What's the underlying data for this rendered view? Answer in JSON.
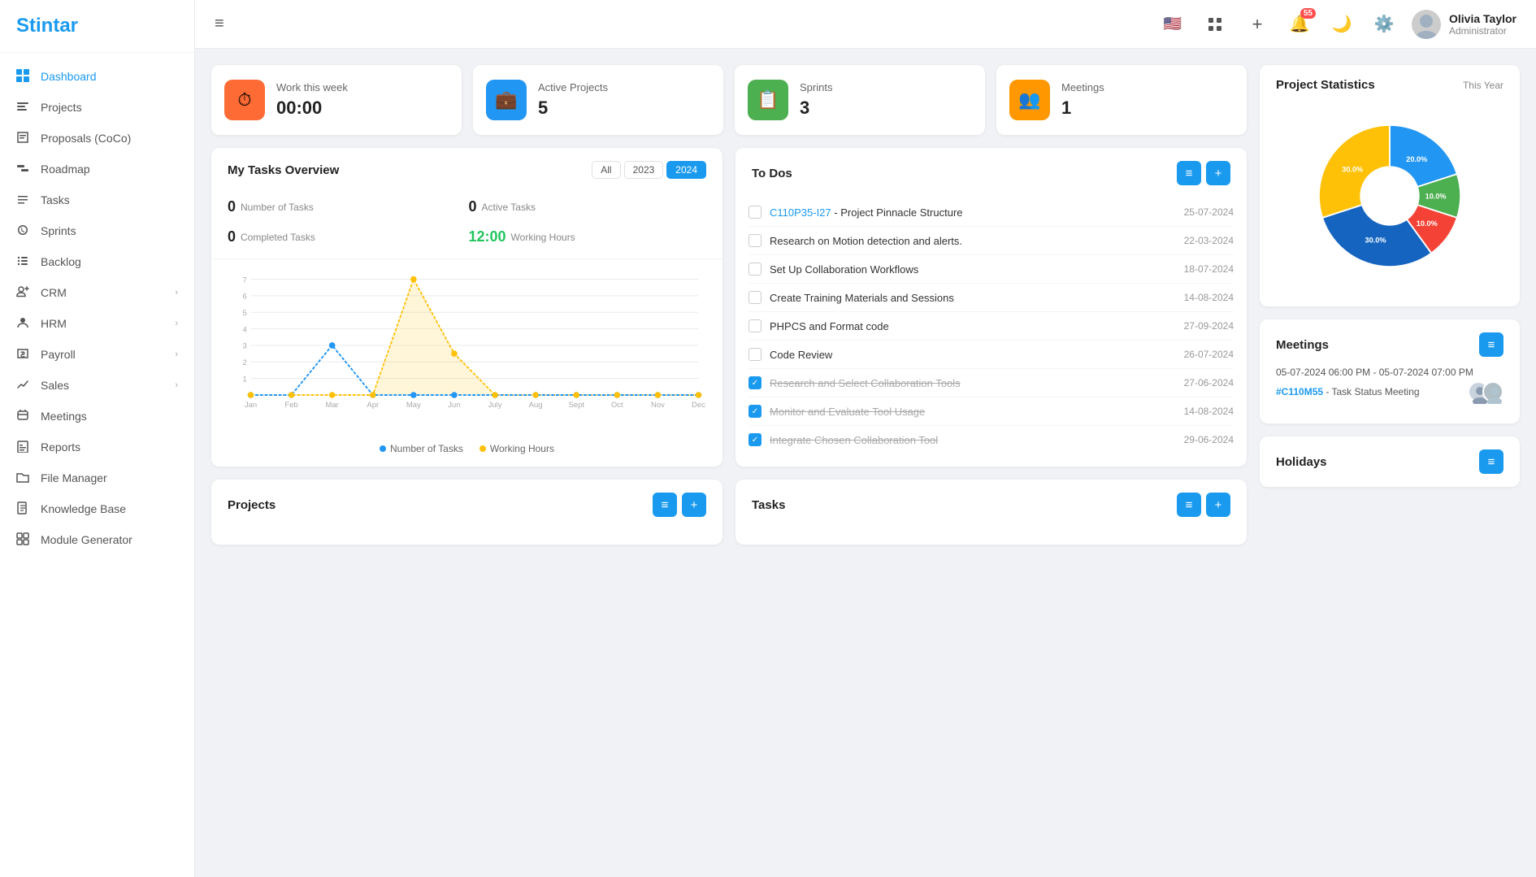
{
  "app": {
    "name": "Stintar"
  },
  "header": {
    "hamburger": "≡",
    "notifications_badge": "55",
    "user": {
      "name": "Olivia Taylor",
      "role": "Administrator"
    }
  },
  "sidebar": {
    "items": [
      {
        "id": "dashboard",
        "label": "Dashboard",
        "icon": "dashboard",
        "active": true,
        "hasArrow": false
      },
      {
        "id": "projects",
        "label": "Projects",
        "icon": "projects",
        "active": false,
        "hasArrow": false
      },
      {
        "id": "proposals",
        "label": "Proposals (CoCo)",
        "icon": "proposals",
        "active": false,
        "hasArrow": false
      },
      {
        "id": "roadmap",
        "label": "Roadmap",
        "icon": "roadmap",
        "active": false,
        "hasArrow": false
      },
      {
        "id": "tasks",
        "label": "Tasks",
        "icon": "tasks",
        "active": false,
        "hasArrow": false
      },
      {
        "id": "sprints",
        "label": "Sprints",
        "icon": "sprints",
        "active": false,
        "hasArrow": false
      },
      {
        "id": "backlog",
        "label": "Backlog",
        "icon": "backlog",
        "active": false,
        "hasArrow": false
      },
      {
        "id": "crm",
        "label": "CRM",
        "icon": "crm",
        "active": false,
        "hasArrow": true
      },
      {
        "id": "hrm",
        "label": "HRM",
        "icon": "hrm",
        "active": false,
        "hasArrow": true
      },
      {
        "id": "payroll",
        "label": "Payroll",
        "icon": "payroll",
        "active": false,
        "hasArrow": true
      },
      {
        "id": "sales",
        "label": "Sales",
        "icon": "sales",
        "active": false,
        "hasArrow": true
      },
      {
        "id": "meetings",
        "label": "Meetings",
        "icon": "meetings",
        "active": false,
        "hasArrow": false
      },
      {
        "id": "reports",
        "label": "Reports",
        "icon": "reports",
        "active": false,
        "hasArrow": false
      },
      {
        "id": "filemanager",
        "label": "File Manager",
        "icon": "filemanager",
        "active": false,
        "hasArrow": false
      },
      {
        "id": "knowledgebase",
        "label": "Knowledge Base",
        "icon": "knowledgebase",
        "active": false,
        "hasArrow": false
      },
      {
        "id": "modulegenerator",
        "label": "Module Generator",
        "icon": "modulegenerator",
        "active": false,
        "hasArrow": false
      }
    ]
  },
  "stat_cards": [
    {
      "id": "work_this_week",
      "icon": "⏱",
      "icon_bg": "#ff6b35",
      "label": "Work this week",
      "value": "00:00"
    },
    {
      "id": "active_projects",
      "icon": "💼",
      "icon_bg": "#2196f3",
      "label": "Active Projects",
      "value": "5"
    },
    {
      "id": "sprints",
      "icon": "📋",
      "icon_bg": "#4caf50",
      "label": "Sprints",
      "value": "3"
    },
    {
      "id": "meetings",
      "icon": "👥",
      "icon_bg": "#ff9800",
      "label": "Meetings",
      "value": "1"
    }
  ],
  "tasks_overview": {
    "title": "My Tasks Overview",
    "tabs": [
      "All",
      "2023",
      "2024"
    ],
    "active_tab": "2024",
    "stats": [
      {
        "num": "0",
        "label": "Number of Tasks"
      },
      {
        "num": "0",
        "label": "Active Tasks"
      },
      {
        "num": "0",
        "label": "Completed Tasks"
      },
      {
        "num": "12:00",
        "label": "Working Hours",
        "green": true
      }
    ],
    "chart_months": [
      "Jan",
      "Feb",
      "Mar",
      "Apr",
      "May",
      "Jun",
      "July",
      "Aug",
      "Sept",
      "Oct",
      "Nov",
      "Dec"
    ],
    "chart_tasks": [
      0,
      0,
      3,
      0,
      0,
      0,
      0,
      0,
      0,
      0,
      0,
      0
    ],
    "chart_hours": [
      0,
      0,
      0,
      0,
      7,
      2.5,
      0,
      0,
      0,
      0,
      0,
      0
    ],
    "legend": [
      {
        "label": "Number of Tasks",
        "color": "#2196f3"
      },
      {
        "label": "Working Hours",
        "color": "#ffc107"
      }
    ]
  },
  "todos": {
    "title": "To Dos",
    "items": [
      {
        "id": "t1",
        "checked": false,
        "link": "C110P35-I27",
        "text": " - Project Pinnacle Structure",
        "date": "25-07-2024"
      },
      {
        "id": "t2",
        "checked": false,
        "link": "",
        "text": "Research on Motion detection and alerts.",
        "date": "22-03-2024"
      },
      {
        "id": "t3",
        "checked": false,
        "link": "",
        "text": "Set Up Collaboration Workflows",
        "date": "18-07-2024"
      },
      {
        "id": "t4",
        "checked": false,
        "link": "",
        "text": "Create Training Materials and Sessions",
        "date": "14-08-2024"
      },
      {
        "id": "t5",
        "checked": false,
        "link": "",
        "text": "PHPCS and Format code",
        "date": "27-09-2024"
      },
      {
        "id": "t6",
        "checked": false,
        "link": "",
        "text": "Code Review",
        "date": "26-07-2024"
      },
      {
        "id": "t7",
        "checked": true,
        "link": "",
        "text": "Research and Select Collaboration Tools",
        "date": "27-06-2024"
      },
      {
        "id": "t8",
        "checked": true,
        "link": "",
        "text": "Monitor and Evaluate Tool Usage",
        "date": "14-08-2024"
      },
      {
        "id": "t9",
        "checked": true,
        "link": "",
        "text": "Integrate Chosen Collaboration Tool",
        "date": "29-06-2024"
      }
    ]
  },
  "project_statistics": {
    "title": "Project Statistics",
    "period": "This Year",
    "slices": [
      {
        "label": "20.0%",
        "color": "#2196f3",
        "value": 20
      },
      {
        "label": "10.0%",
        "color": "#4caf50",
        "value": 10
      },
      {
        "label": "10.0%",
        "color": "#f44336",
        "value": 10
      },
      {
        "label": "30.0%",
        "color": "#2196f3",
        "value": 30,
        "dark": true
      },
      {
        "label": "30.0%",
        "color": "#ffc107",
        "value": 30
      }
    ]
  },
  "meetings_card": {
    "title": "Meetings",
    "entries": [
      {
        "datetime": "05-07-2024 06:00 PM - 05-07-2024 07:00 PM",
        "link": "#C110M55",
        "name": "Task Status Meeting"
      }
    ]
  },
  "sections_bottom": {
    "projects_label": "Projects",
    "tasks_label": "Tasks",
    "holidays_label": "Holidays"
  }
}
